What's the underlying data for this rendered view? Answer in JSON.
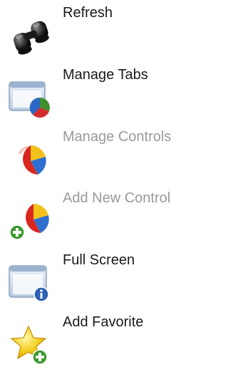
{
  "menu": {
    "items": [
      {
        "label": "Refresh",
        "icon": "binoculars-icon",
        "enabled": true
      },
      {
        "label": "Manage Tabs",
        "icon": "window-pie-chart-icon",
        "enabled": true
      },
      {
        "label": "Manage Controls",
        "icon": "pie-chart-icon",
        "enabled": false
      },
      {
        "label": "Add New Control",
        "icon": "pie-chart-add-icon",
        "enabled": false
      },
      {
        "label": "Full Screen",
        "icon": "window-info-icon",
        "enabled": true
      },
      {
        "label": "Add Favorite",
        "icon": "star-add-icon",
        "enabled": true
      }
    ]
  }
}
